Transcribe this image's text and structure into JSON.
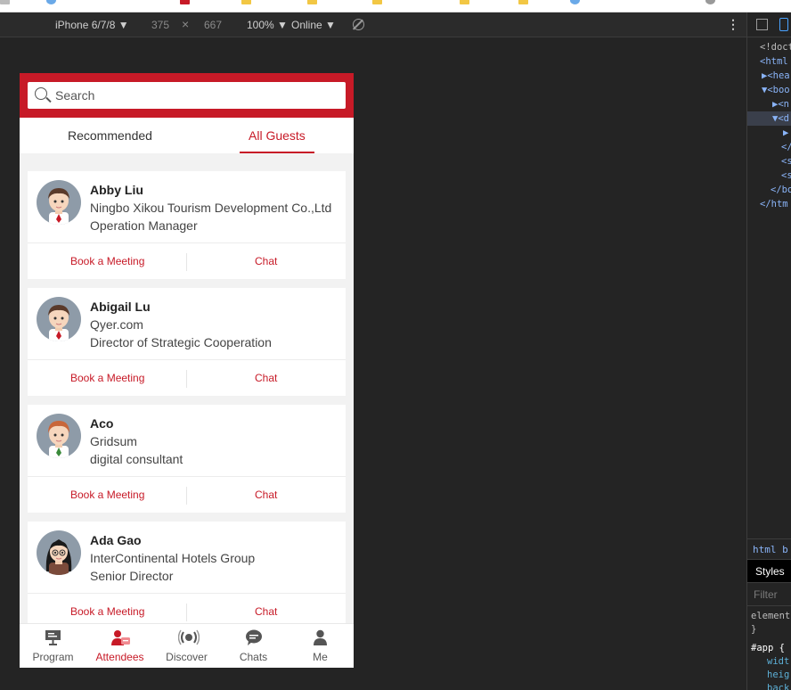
{
  "devtools_toolbar": {
    "device": "iPhone 6/7/8 ▼",
    "width": "375",
    "times": "×",
    "height": "667",
    "zoom": "100% ▼",
    "network": "Online ▼",
    "more": "⋮"
  },
  "devtools_panel": {
    "dom": [
      "<!doct",
      "<html",
      "▶<hea",
      "▼<boo",
      "▶<n",
      "▼<d",
      "▶",
      "</",
      "<s",
      "<s",
      "</bo",
      "</htm"
    ],
    "crumb": "html  b",
    "styles_tab": "Styles",
    "filter": "Filter",
    "css": [
      "element",
      "}",
      "#app {",
      "widt",
      "heig",
      "back"
    ]
  },
  "search": {
    "placeholder": "Search"
  },
  "tabs": [
    {
      "label": "Recommended"
    },
    {
      "label": "All Guests",
      "active": true
    }
  ],
  "guests": [
    {
      "name": "Abby Liu",
      "company": "Ningbo Xikou Tourism Development Co.,Ltd",
      "title": "Operation Manager"
    },
    {
      "name": "Abigail Lu",
      "company": "Qyer.com",
      "title": "Director of Strategic Cooperation"
    },
    {
      "name": "Aco",
      "company": "Gridsum",
      "title": "digital consultant"
    },
    {
      "name": "Ada Gao",
      "company": "InterContinental Hotels Group",
      "title": "Senior Director"
    }
  ],
  "actions": {
    "book": "Book a Meeting",
    "chat": "Chat"
  },
  "tabbar": [
    {
      "label": "Program",
      "icon": "presentation-icon"
    },
    {
      "label": "Attendees",
      "icon": "attendees-icon",
      "active": true
    },
    {
      "label": "Discover",
      "icon": "broadcast-icon"
    },
    {
      "label": "Chats",
      "icon": "chat-bubble-icon"
    },
    {
      "label": "Me",
      "icon": "person-icon"
    }
  ],
  "colors": {
    "brand": "#c71a27",
    "background": "#f2f2f2",
    "devtools": "#242424"
  }
}
